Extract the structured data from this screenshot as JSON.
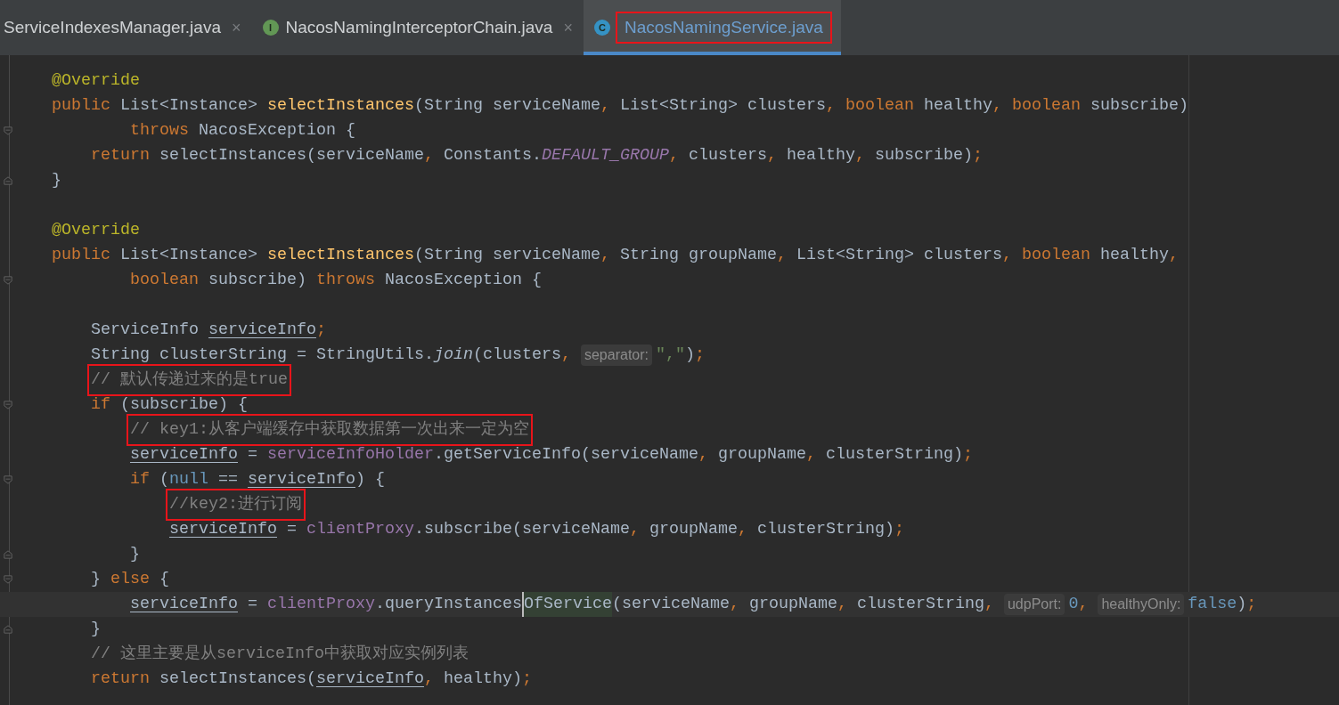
{
  "tabs": [
    {
      "label": "ServiceIndexesManager.java",
      "selected": false,
      "boxed": false,
      "close": "×"
    },
    {
      "label": "NacosNamingInterceptorChain.java",
      "icon_letter": "I",
      "color": "#629755",
      "selected": false,
      "boxed": false,
      "close": "×"
    },
    {
      "label": "NacosNamingService.java",
      "icon_letter": "C",
      "color": "#3592c4",
      "selected": true,
      "boxed": true
    }
  ],
  "editor": {
    "lines": [
      {
        "kind": "code",
        "current": false,
        "tokens": [
          {
            "kind": "annotation",
            "text": "    @Override"
          }
        ]
      },
      {
        "kind": "code",
        "current": false,
        "tokens": [
          {
            "kind": "keyword",
            "text": "    public "
          },
          {
            "kind": "plain",
            "text": "List<Instance> "
          },
          {
            "kind": "declaration",
            "text": "selectInstances"
          },
          {
            "kind": "plain",
            "text": "(String serviceName"
          },
          {
            "kind": "keyword",
            "text": ", "
          },
          {
            "kind": "plain",
            "text": "List<String> clusters"
          },
          {
            "kind": "keyword",
            "text": ", boolean "
          },
          {
            "kind": "plain",
            "text": "healthy"
          },
          {
            "kind": "keyword",
            "text": ", boolean "
          },
          {
            "kind": "plain",
            "text": "subscribe)"
          }
        ]
      },
      {
        "kind": "fold-start",
        "current": false,
        "tokens": [
          {
            "kind": "keyword",
            "text": "            throws "
          },
          {
            "kind": "plain",
            "text": "NacosException {"
          }
        ]
      },
      {
        "kind": "code",
        "current": false,
        "tokens": [
          {
            "kind": "keyword",
            "text": "        return "
          },
          {
            "kind": "plain",
            "text": "selectInstances(serviceName"
          },
          {
            "kind": "keyword",
            "text": ", "
          },
          {
            "kind": "plain",
            "text": "Constants."
          },
          {
            "kind": "constant",
            "text": "DEFAULT_GROUP"
          },
          {
            "kind": "keyword",
            "text": ", "
          },
          {
            "kind": "plain",
            "text": "clusters"
          },
          {
            "kind": "keyword",
            "text": ", "
          },
          {
            "kind": "plain",
            "text": "healthy"
          },
          {
            "kind": "keyword",
            "text": ", "
          },
          {
            "kind": "plain",
            "text": "subscribe)"
          },
          {
            "kind": "keyword",
            "text": ";"
          }
        ]
      },
      {
        "kind": "fold-end",
        "current": false,
        "tokens": [
          {
            "kind": "plain",
            "text": "    }"
          }
        ]
      },
      {
        "kind": "blank",
        "current": false
      },
      {
        "kind": "code",
        "current": false,
        "tokens": [
          {
            "kind": "annotation",
            "text": "    @Override"
          }
        ]
      },
      {
        "kind": "code",
        "current": false,
        "tokens": [
          {
            "kind": "keyword",
            "text": "    public "
          },
          {
            "kind": "plain",
            "text": "List<Instance> "
          },
          {
            "kind": "declaration",
            "text": "selectInstances"
          },
          {
            "kind": "plain",
            "text": "(String serviceName"
          },
          {
            "kind": "keyword",
            "text": ", "
          },
          {
            "kind": "plain",
            "text": "String groupName"
          },
          {
            "kind": "keyword",
            "text": ", "
          },
          {
            "kind": "plain",
            "text": "List<String> clusters"
          },
          {
            "kind": "keyword",
            "text": ", boolean "
          },
          {
            "kind": "plain",
            "text": "healthy"
          },
          {
            "kind": "keyword",
            "text": ","
          }
        ]
      },
      {
        "kind": "fold-start",
        "current": false,
        "tokens": [
          {
            "kind": "keyword",
            "text": "            boolean "
          },
          {
            "kind": "plain",
            "text": "subscribe) "
          },
          {
            "kind": "keyword",
            "text": "throws "
          },
          {
            "kind": "plain",
            "text": "NacosException {"
          }
        ]
      },
      {
        "kind": "blank",
        "current": false
      },
      {
        "kind": "code",
        "current": false,
        "tokens": [
          {
            "kind": "plain",
            "text": "        ServiceInfo "
          },
          {
            "kind": "variable",
            "text": "serviceInfo"
          },
          {
            "kind": "keyword",
            "text": ";"
          }
        ]
      },
      {
        "kind": "code",
        "current": false,
        "tokens": [
          {
            "kind": "plain",
            "text": "        String clusterString = StringUtils."
          },
          {
            "kind": "static-call",
            "text": "join"
          },
          {
            "kind": "plain",
            "text": "(clusters"
          },
          {
            "kind": "keyword",
            "text": ", "
          },
          {
            "kind": "hint",
            "text": "separator:"
          },
          {
            "kind": "string",
            "text": "\",\""
          },
          {
            "kind": "plain",
            "text": ")"
          },
          {
            "kind": "keyword",
            "text": ";"
          }
        ]
      },
      {
        "kind": "code",
        "current": false,
        "tokens": [
          {
            "kind": "comment",
            "text": "        // 默认传递过来的是true",
            "boxed": true
          }
        ]
      },
      {
        "kind": "fold-start",
        "current": false,
        "tokens": [
          {
            "kind": "keyword",
            "text": "        if "
          },
          {
            "kind": "plain",
            "text": "(subscribe) {"
          }
        ]
      },
      {
        "kind": "code",
        "current": false,
        "tokens": [
          {
            "kind": "comment",
            "text": "            // key1:从客户端缓存中获取数据第一次出来一定为空",
            "boxed": true
          }
        ]
      },
      {
        "kind": "code",
        "current": false,
        "tokens": [
          {
            "kind": "variable",
            "text": "            serviceInfo"
          },
          {
            "kind": "plain",
            "text": " = "
          },
          {
            "kind": "field",
            "text": "serviceInfoHolder"
          },
          {
            "kind": "plain",
            "text": ".getServiceInfo(serviceName"
          },
          {
            "kind": "keyword",
            "text": ", "
          },
          {
            "kind": "plain",
            "text": "groupName"
          },
          {
            "kind": "keyword",
            "text": ", "
          },
          {
            "kind": "plain",
            "text": "clusterString)"
          },
          {
            "kind": "keyword",
            "text": ";"
          }
        ]
      },
      {
        "kind": "fold-start",
        "current": false,
        "tokens": [
          {
            "kind": "keyword",
            "text": "            if "
          },
          {
            "kind": "plain",
            "text": "("
          },
          {
            "kind": "literal",
            "text": "null"
          },
          {
            "kind": "plain",
            "text": " == "
          },
          {
            "kind": "variable",
            "text": "serviceInfo"
          },
          {
            "kind": "plain",
            "text": ") {"
          }
        ]
      },
      {
        "kind": "code",
        "current": false,
        "tokens": [
          {
            "kind": "comment",
            "text": "                //key2:进行订阅",
            "boxed": true
          }
        ]
      },
      {
        "kind": "code",
        "current": false,
        "tokens": [
          {
            "kind": "variable",
            "text": "                serviceInfo"
          },
          {
            "kind": "plain",
            "text": " = "
          },
          {
            "kind": "field",
            "text": "clientProxy"
          },
          {
            "kind": "plain",
            "text": ".subscribe(serviceName"
          },
          {
            "kind": "keyword",
            "text": ", "
          },
          {
            "kind": "plain",
            "text": "groupName"
          },
          {
            "kind": "keyword",
            "text": ", "
          },
          {
            "kind": "plain",
            "text": "clusterString)"
          },
          {
            "kind": "keyword",
            "text": ";"
          }
        ]
      },
      {
        "kind": "fold-end",
        "current": false,
        "tokens": [
          {
            "kind": "plain",
            "text": "            }"
          }
        ]
      },
      {
        "kind": "fold-start",
        "current": false,
        "tokens": [
          {
            "kind": "plain",
            "text": "        } "
          },
          {
            "kind": "keyword",
            "text": "else "
          },
          {
            "kind": "plain",
            "text": "{"
          }
        ]
      },
      {
        "kind": "code",
        "current": true,
        "tokens": [
          {
            "kind": "variable",
            "text": "            serviceInfo"
          },
          {
            "kind": "plain",
            "text": " = "
          },
          {
            "kind": "field",
            "text": "clientProxy"
          },
          {
            "kind": "plain",
            "text": ".queryInstances"
          },
          {
            "kind": "plain",
            "text": "OfService",
            "highlighted": true,
            "caret": true
          },
          {
            "kind": "plain",
            "text": "(serviceName"
          },
          {
            "kind": "keyword",
            "text": ", "
          },
          {
            "kind": "plain",
            "text": "groupName"
          },
          {
            "kind": "keyword",
            "text": ", "
          },
          {
            "kind": "plain",
            "text": "clusterString"
          },
          {
            "kind": "keyword",
            "text": ", "
          },
          {
            "kind": "hint",
            "text": "udpPort:"
          },
          {
            "kind": "literal",
            "text": "0"
          },
          {
            "kind": "keyword",
            "text": ", "
          },
          {
            "kind": "hint",
            "text": "healthyOnly:"
          },
          {
            "kind": "literal",
            "text": "false"
          },
          {
            "kind": "plain",
            "text": ")"
          },
          {
            "kind": "keyword",
            "text": ";"
          }
        ]
      },
      {
        "kind": "fold-end",
        "current": false,
        "tokens": [
          {
            "kind": "plain",
            "text": "        }"
          }
        ]
      },
      {
        "kind": "code",
        "current": false,
        "tokens": [
          {
            "kind": "comment",
            "text": "        // 这里主要是从serviceInfo中获取对应实例列表"
          }
        ]
      },
      {
        "kind": "code",
        "current": false,
        "tokens": [
          {
            "kind": "keyword",
            "text": "        return "
          },
          {
            "kind": "plain",
            "text": "selectInstances("
          },
          {
            "kind": "variable",
            "text": "serviceInfo"
          },
          {
            "kind": "keyword",
            "text": ", "
          },
          {
            "kind": "plain",
            "text": "healthy)"
          },
          {
            "kind": "keyword",
            "text": ";"
          }
        ]
      }
    ]
  }
}
